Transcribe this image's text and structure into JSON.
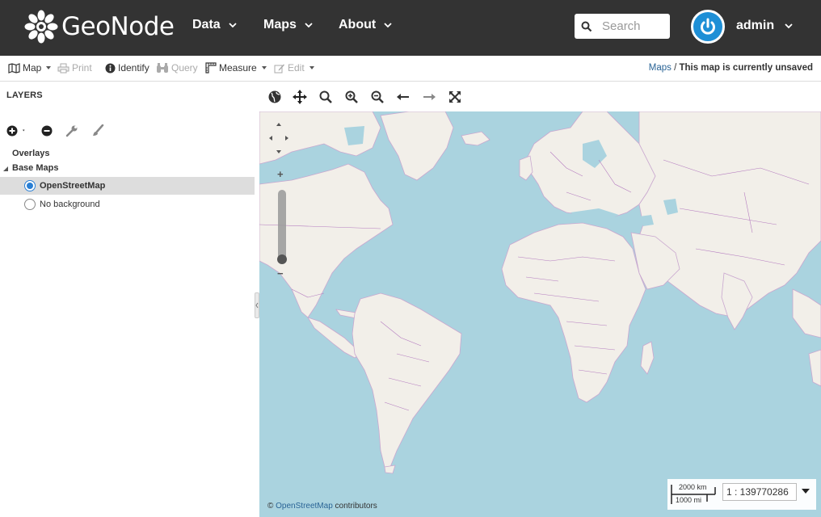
{
  "navbar": {
    "brand": "GeoNode",
    "items": [
      {
        "label": "Data"
      },
      {
        "label": "Maps"
      },
      {
        "label": "About"
      }
    ],
    "search_placeholder": "Search",
    "user": "admin",
    "colors": {
      "bg": "#333333",
      "avatar": "#1e8fd6"
    }
  },
  "toolbar": {
    "map_label": "Map",
    "print_label": "Print",
    "identify_label": "Identify",
    "query_label": "Query",
    "measure_label": "Measure",
    "edit_label": "Edit",
    "breadcrumb_link": "Maps",
    "breadcrumb_sep": " / ",
    "breadcrumb_current": "This map is currently unsaved"
  },
  "layers": {
    "title": "LAYERS",
    "groups": [
      {
        "label": "Overlays"
      },
      {
        "label": "Base Maps"
      }
    ],
    "items": [
      {
        "label": "OpenStreetMap",
        "selected": true
      },
      {
        "label": "No background",
        "selected": false
      }
    ]
  },
  "map": {
    "scale_km": "2000 km",
    "scale_mi": "1000 mi",
    "scale_value": "1 : 139770286",
    "attribution_prefix": "© ",
    "attribution_link": "OpenStreetMap",
    "attribution_suffix": " contributors",
    "colors": {
      "ocean": "#aad3df",
      "land": "#f2efe9",
      "borders": "#b47bbf"
    }
  }
}
